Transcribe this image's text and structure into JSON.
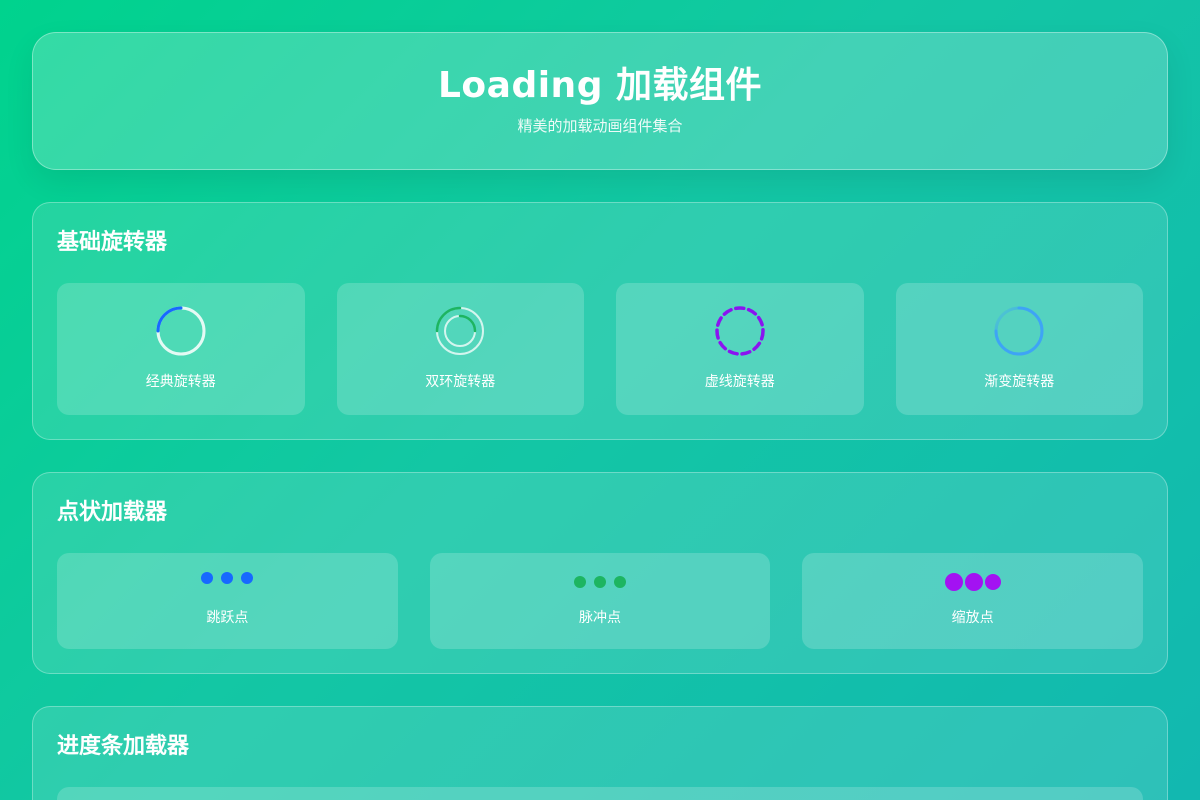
{
  "header": {
    "title": "Loading 加载组件",
    "subtitle": "精美的加载动画组件集合"
  },
  "sections": {
    "spinners": {
      "title": "基础旋转器",
      "items": [
        {
          "label": "经典旋转器",
          "icon": "classic-spinner-icon",
          "color": "#1769ff"
        },
        {
          "label": "双环旋转器",
          "icon": "double-ring-spinner-icon",
          "color": "#1db561"
        },
        {
          "label": "虚线旋转器",
          "icon": "dashed-spinner-icon",
          "color": "#8a14f0"
        },
        {
          "label": "渐变旋转器",
          "icon": "gradient-spinner-icon",
          "color": "#3ea4f5"
        }
      ]
    },
    "dots": {
      "title": "点状加载器",
      "items": [
        {
          "label": "跳跃点",
          "icon": "bouncing-dots-icon",
          "color": "#1769ff"
        },
        {
          "label": "脉冲点",
          "icon": "pulse-dots-icon",
          "color": "#1db561"
        },
        {
          "label": "缩放点",
          "icon": "scaling-dots-icon",
          "color": "#a312f2"
        }
      ]
    },
    "progress": {
      "title": "进度条加载器"
    }
  }
}
